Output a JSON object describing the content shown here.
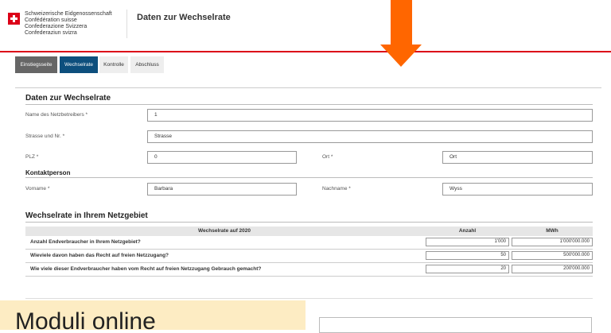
{
  "header": {
    "brand_lines": [
      "Schweizerische Eidgenossenschaft",
      "Confédération suisse",
      "Confederazione Svizzera",
      "Confederaziun svizra"
    ],
    "title": "Daten zur Wechselrate"
  },
  "tabs": [
    {
      "label": "Einstiegsseite"
    },
    {
      "label": "Wechselrate"
    },
    {
      "label": "Kontrolle"
    },
    {
      "label": "Abschluss"
    }
  ],
  "form": {
    "section_title": "Daten zur Wechselrate",
    "operator_name_label": "Name des Netzbetreibers *",
    "operator_name_value": "1",
    "street_label": "Strasse und Nr. *",
    "street_value": "Strasse",
    "zip_label": "PLZ *",
    "zip_value": "0",
    "city_label": "Ort *",
    "city_value": "Ort",
    "contact_title": "Kontaktperson",
    "firstname_label": "Vorname *",
    "firstname_value": "Barbara",
    "lastname_label": "Nachname *",
    "lastname_value": "Wyss"
  },
  "table": {
    "section_title": "Wechselrate in Ihrem Netzgebiet",
    "col_question": "Wechselrate auf 2020",
    "col_count": "Anzahl",
    "col_mwh": "MWh",
    "rows": [
      {
        "question": "Anzahl Endverbraucher in Ihrem Netzgebiet?",
        "count": "1'000",
        "mwh": "1'000'000.000"
      },
      {
        "question": "Wieviele davon haben das Recht auf freien Netzzugang?",
        "count": "50",
        "mwh": "500'000.000"
      },
      {
        "question": "Wie viele dieser Endverbraucher haben vom Recht auf freien Netzzugang Gebrauch gemacht?",
        "count": "20",
        "mwh": "200'000.000"
      }
    ]
  },
  "note": {
    "text": "Moduli online"
  },
  "colors": {
    "accent_red": "#dc0018",
    "arrow": "#ff6600",
    "tab_current": "#0d4f7d"
  }
}
